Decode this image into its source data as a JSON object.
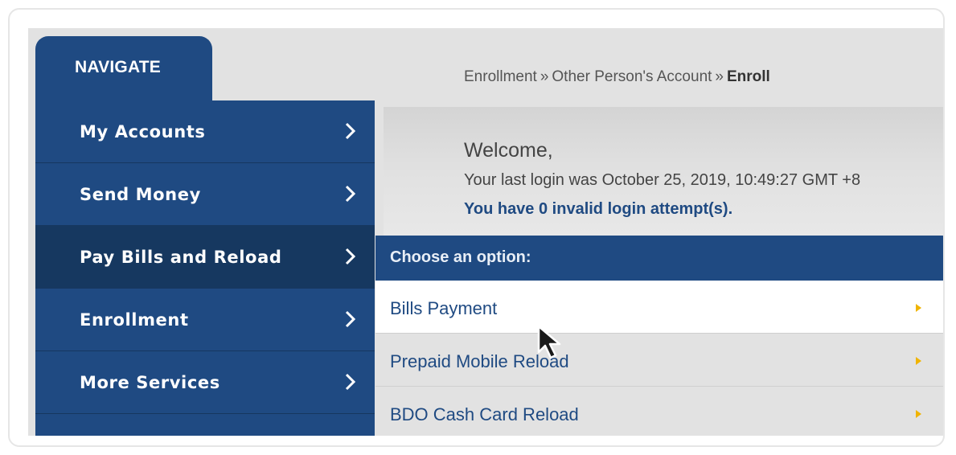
{
  "nav_tab": {
    "label": "NAVIGATE"
  },
  "sidebar": {
    "items": [
      {
        "label": "My Accounts"
      },
      {
        "label": "Send Money"
      },
      {
        "label": "Pay Bills and Reload"
      },
      {
        "label": "Enrollment"
      },
      {
        "label": "More Services"
      }
    ],
    "active_index": 2
  },
  "breadcrumb": {
    "items": [
      "Enrollment",
      "Other Person's Account"
    ],
    "separator": "»",
    "current": "Enroll"
  },
  "welcome": {
    "title": "Welcome,",
    "last_login": "Your last login was October 25, 2019, 10:49:27 GMT +8",
    "invalid_attempts": "You have 0 invalid login attempt(s)."
  },
  "options": {
    "header": "Choose an option:",
    "items": [
      {
        "label": "Bills Payment"
      },
      {
        "label": "Prepaid Mobile Reload"
      },
      {
        "label": "BDO Cash Card Reload"
      }
    ],
    "hovered_index": 0
  },
  "colors": {
    "primary": "#1f4a82",
    "active_nav": "#163860",
    "accent_arrow": "#f0b400",
    "background": "#e2e2e2"
  },
  "icons": {
    "sidebar_chevron": "chevron-right-icon",
    "option_arrow": "caret-right-icon",
    "cursor": "mouse-pointer-icon"
  }
}
